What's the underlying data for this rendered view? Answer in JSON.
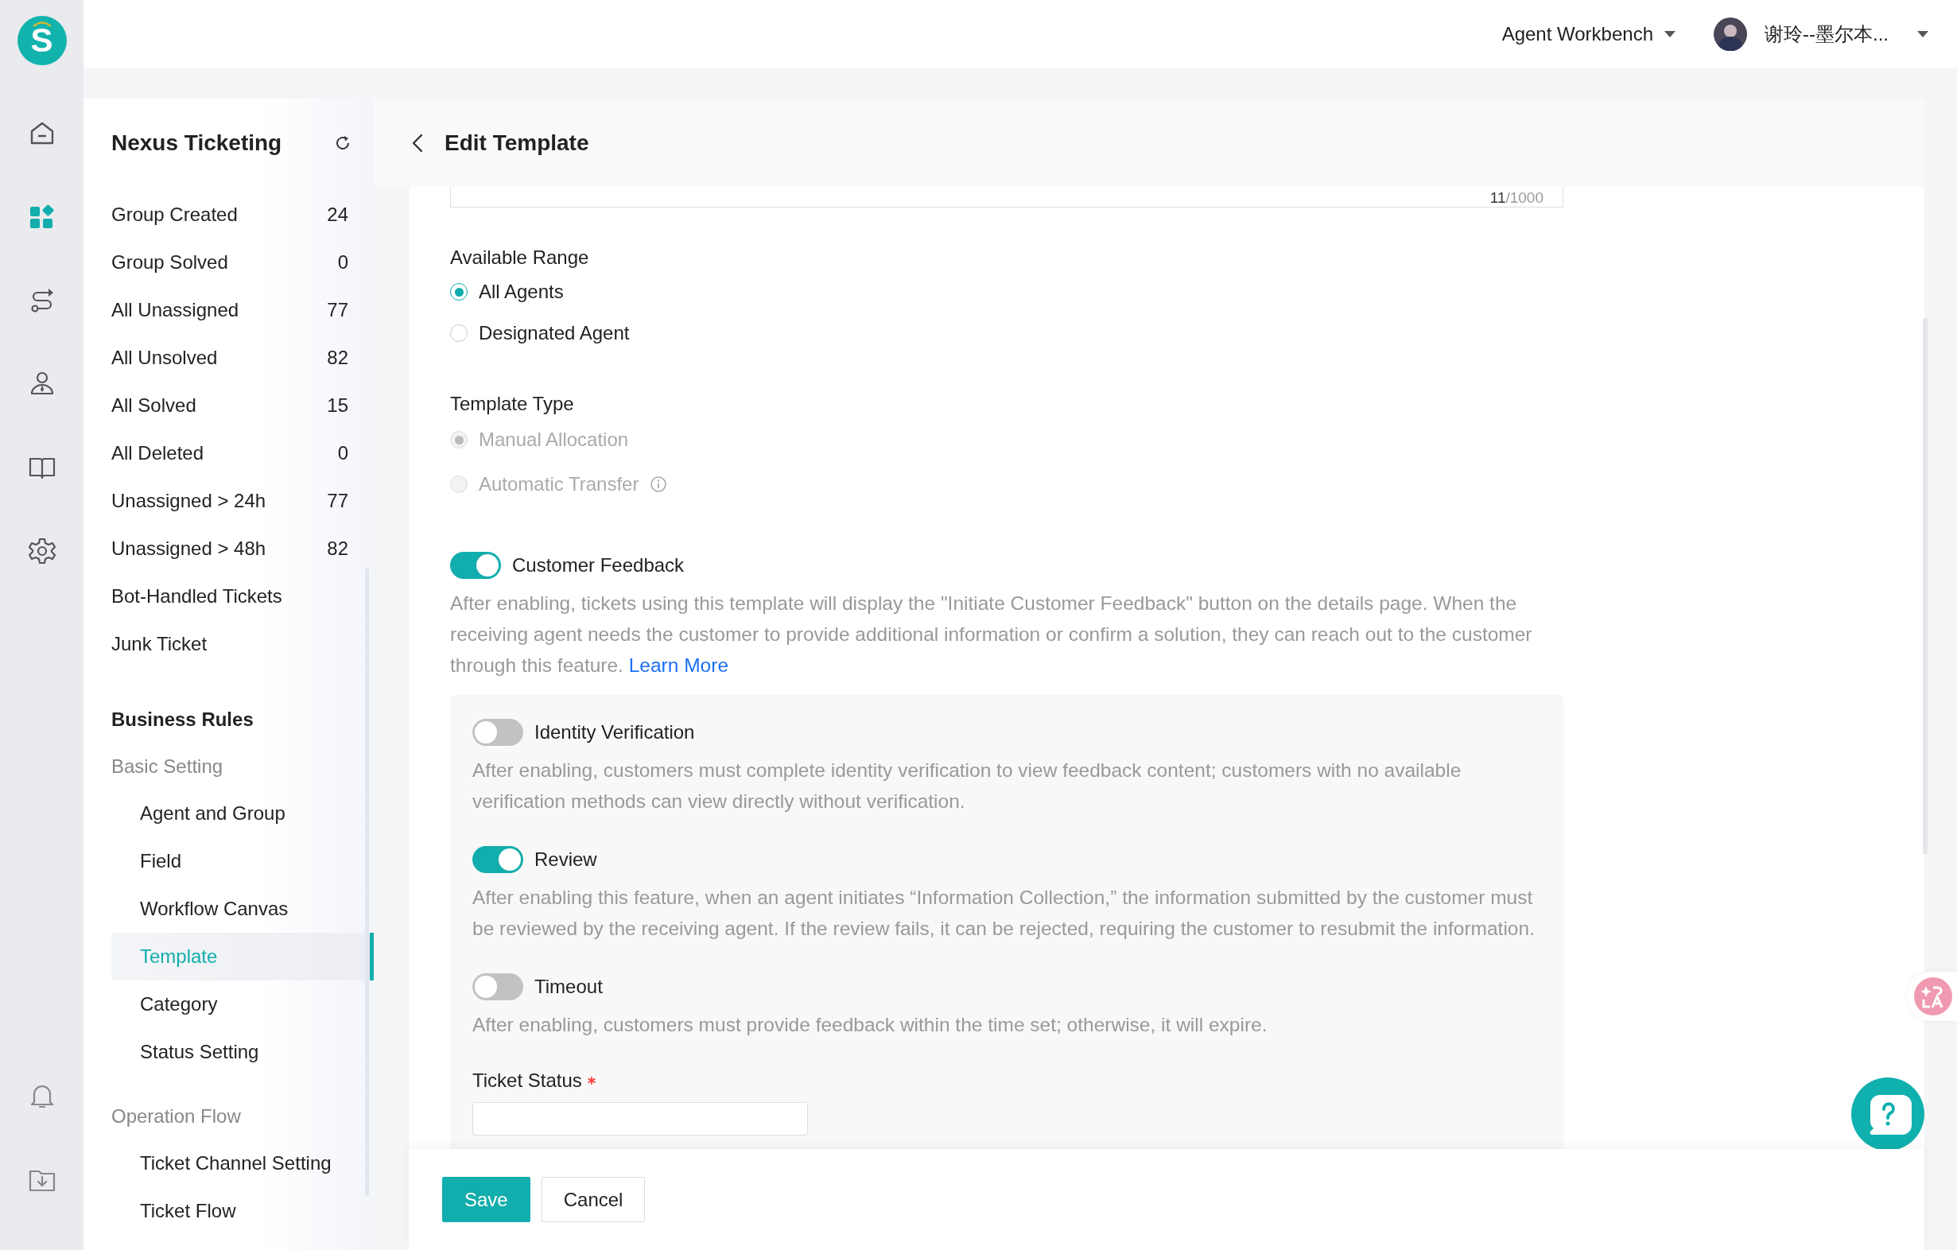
{
  "logo": {
    "text": "S"
  },
  "rail": {
    "items": [
      {
        "kind": "home",
        "selected": false
      },
      {
        "kind": "apps",
        "selected": true
      },
      {
        "kind": "route",
        "selected": false
      },
      {
        "kind": "agent",
        "selected": false
      },
      {
        "kind": "book",
        "selected": false
      },
      {
        "kind": "settings",
        "selected": false
      }
    ],
    "bottom": [
      {
        "kind": "bell"
      },
      {
        "kind": "download"
      }
    ]
  },
  "topbar": {
    "workspace": "Agent Workbench",
    "user": "谢玲--墨尔本..."
  },
  "sidebar": {
    "title": "Nexus Ticketing",
    "views": [
      {
        "label": "Group Created",
        "count": "24"
      },
      {
        "label": "Group Solved",
        "count": "0"
      },
      {
        "label": "All Unassigned",
        "count": "77"
      },
      {
        "label": "All Unsolved",
        "count": "82"
      },
      {
        "label": "All Solved",
        "count": "15"
      },
      {
        "label": "All Deleted",
        "count": "0"
      },
      {
        "label": "Unassigned > 24h",
        "count": "77"
      },
      {
        "label": "Unassigned > 48h",
        "count": "82"
      },
      {
        "label": "Bot-Handled Tickets"
      },
      {
        "label": "Junk Ticket"
      }
    ],
    "section": {
      "title": "Business Rules",
      "groups": [
        {
          "title": "Basic Setting",
          "items": [
            {
              "label": "Agent and Group",
              "selected": false
            },
            {
              "label": "Field",
              "selected": false
            },
            {
              "label": "Workflow Canvas",
              "selected": false
            },
            {
              "label": "Template",
              "selected": true
            },
            {
              "label": "Category",
              "selected": false
            },
            {
              "label": "Status Setting",
              "selected": false
            }
          ]
        },
        {
          "title": "Operation Flow",
          "items": [
            {
              "label": "Ticket Channel Setting",
              "selected": false
            },
            {
              "label": "Ticket Flow",
              "selected": false
            }
          ]
        }
      ]
    }
  },
  "page": {
    "title": "Edit Template",
    "counter": {
      "count": "11",
      "max": "/1000"
    },
    "available_range": {
      "label": "Available Range",
      "disabled": false,
      "options": [
        {
          "label": "All Agents",
          "selected": true
        },
        {
          "label": "Designated Agent",
          "selected": false
        }
      ]
    },
    "template_type": {
      "label": "Template Type",
      "disabled": true,
      "options": [
        {
          "label": "Manual Allocation",
          "selected": true
        },
        {
          "label": "Automatic Transfer",
          "selected": false,
          "info": true
        }
      ]
    },
    "customer_feedback": {
      "label": "Customer Feedback",
      "on": true,
      "description": "After enabling, tickets using this template will display the \"Initiate Customer Feedback\" button on the details page. When the receiving agent needs the customer to provide additional information or confirm a solution, they can reach out to the customer through this feature.",
      "link": "Learn More"
    },
    "options": [
      {
        "label": "Identity Verification",
        "on": false,
        "description": "After enabling, customers must complete identity verification to view feedback content; customers with no available verification methods can view directly without verification."
      },
      {
        "label": "Review",
        "on": true,
        "description": "After enabling this feature, when an agent initiates “Information Collection,” the information submitted by the customer must be reviewed by the receiving agent. If the review fails, it can be rejected, requiring the customer to resubmit the information."
      },
      {
        "label": "Timeout",
        "on": false,
        "description": "After enabling, customers must provide feedback within the time set; otherwise, it will expire."
      }
    ],
    "ticket_status": {
      "label": "Ticket Status",
      "required": true
    }
  },
  "footer": {
    "buttons": [
      {
        "label": "Save",
        "kind": "primary"
      },
      {
        "label": "Cancel",
        "kind": "default"
      }
    ]
  }
}
